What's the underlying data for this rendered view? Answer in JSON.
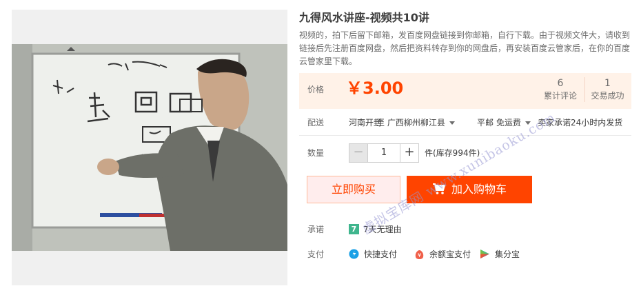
{
  "product": {
    "title": "九得风水讲座-视频共10讲",
    "description": "视频的，拍下后留下邮箱，发百度网盘链接到你邮箱，自行下载。由于视频文件大，请收到链接后先注册百度网盘，然后把资料转存到你的网盘后，再安装百度云管家后，在你的百度云管家里下载。"
  },
  "price": {
    "label": "价格",
    "value": "￥3.00",
    "comments_count": "6",
    "comments_label": "累计评论",
    "sales_count": "1",
    "sales_label": "交易成功"
  },
  "shipping": {
    "label": "配送",
    "from": "河南开封",
    "to": "至  广西柳州柳江县",
    "method": "平邮 免运费",
    "promise": "卖家承诺24小时内发货"
  },
  "quantity": {
    "label": "数量",
    "minus": "−",
    "value": "1",
    "plus": "+",
    "stock": "件(库存994件)"
  },
  "actions": {
    "buy_now": "立即购买",
    "add_to_cart": "加入购物车"
  },
  "guarantee": {
    "label": "承诺",
    "badge": "7",
    "text": "7天无理由"
  },
  "payment": {
    "label": "支付",
    "methods": [
      {
        "name": "快捷支付",
        "icon": "quick-pay-icon"
      },
      {
        "name": "余额宝支付",
        "icon": "yuebao-icon"
      },
      {
        "name": "集分宝",
        "icon": "jifenbao-icon"
      }
    ]
  },
  "watermark": "虚拟宝库网 www.xunibaoku.com",
  "colors": {
    "accent": "#ff4400",
    "price_bg": "#fff2e8",
    "badge_green": "#3fb58d"
  }
}
